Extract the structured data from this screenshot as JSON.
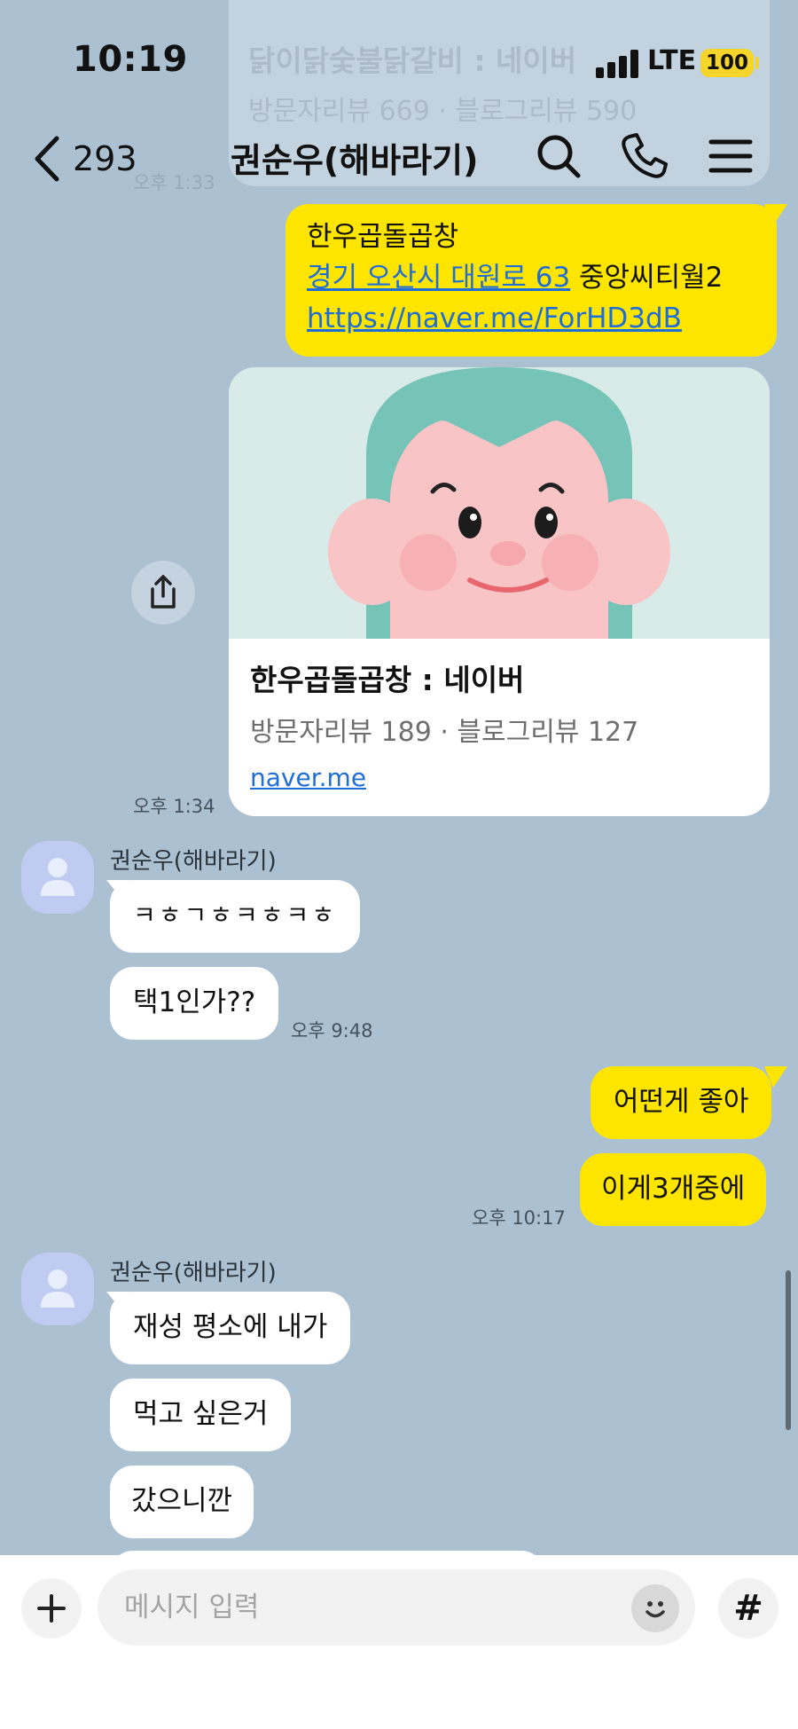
{
  "status_bar": {
    "time": "10:19",
    "network": "LTE",
    "battery": "100"
  },
  "header": {
    "back_count": "293",
    "title": "권순우(해바라기)"
  },
  "ghost": {
    "card_title": "닭이닭숯불닭갈비 : 네이버",
    "card_sub": "방문자리뷰 669 · 블로그리뷰 590",
    "time": "오후 1:33"
  },
  "messages": {
    "m1": {
      "line1": "한우곱돌곱창",
      "address_link": "경기 오산시 대원로 63",
      "address_rest": " 중앙씨티월2",
      "url": "https://naver.me/ForHD3dB"
    },
    "card": {
      "title": "한우곱돌곱창 : 네이버",
      "subtitle": "방문자리뷰 189 · 블로그리뷰 127",
      "link": "naver.me",
      "time": "오후 1:34"
    },
    "group1": {
      "sender": "권순우(해바라기)",
      "b1": "ㅋㅎㄱㅎㅋㅎㅋㅎ",
      "b2": "택1인가??",
      "time": "오후 9:48"
    },
    "mine2": {
      "b1": "어떤게 좋아",
      "b2": "이게3개중에",
      "time": "오후 10:17"
    },
    "group2": {
      "sender": "권순우(해바라기)",
      "b1": "재성 평소에 내가",
      "b2": "먹고 싶은거",
      "b3": "갔으니깐"
    }
  },
  "input": {
    "placeholder": "메시지 입력",
    "hash": "#"
  },
  "colors": {
    "background": "#abc1d1",
    "my_bubble": "#fee500",
    "their_bubble": "#ffffff",
    "link": "#1f6ed8",
    "battery": "#f5d52a"
  }
}
